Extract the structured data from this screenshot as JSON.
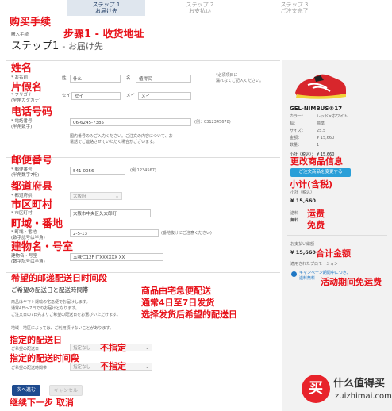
{
  "steps": [
    {
      "line1": "ステップ 1",
      "line2": "お届け先"
    },
    {
      "line1": "ステップ 2",
      "line2": "お支払い"
    },
    {
      "line1": "ステップ 3",
      "line2": "ご注文完了"
    }
  ],
  "header": {
    "subtitle": "購入手続",
    "title": "ステップ1",
    "title_suffix": "- お届け先"
  },
  "form": {
    "name_label": "* お名前",
    "name_sei_label": "姓",
    "name_sei_value": "什么",
    "name_mei_label": "名",
    "name_mei_value": "值得买",
    "required_note": "*必須項目に\n漏れなくご記入ください。",
    "kana_label": "* フリガナ\n(全角カタカナ)",
    "kana_sei_label": "セイ",
    "kana_sei_value": "セイ",
    "kana_mei_label": "メイ",
    "kana_mei_value": "メイ",
    "phone_label": "* 電話番号\n(半角数字)",
    "phone_value": "06-6245-7385",
    "phone_example": "(例：0312345678)",
    "phone_note": "国内番号のみご入力ください。ご注文の内容について、お\n電話でご連絡させていただく場合がございます。",
    "zip_label": "* 郵便番号\n(半角数字7桁)",
    "zip_value": "541-0056",
    "zip_example": "(例:1234567)",
    "pref_label": "* 都道府県",
    "pref_value": "大阪府",
    "city_label": "* 市区町村",
    "city_value": "大阪市中央区久太郎町",
    "street_label": "* 町域・番地\n(数字記号は半角)",
    "street_value": "2-5-13",
    "street_note": "(番地抜けにご注意ください)",
    "building_label": "建物名・号室\n(数字記号は半角)",
    "building_value": "五味仁12F JTXXXXXX XX"
  },
  "delivery": {
    "heading": "ご希望の配送日と配送時間帯",
    "text1": "商品はヤマト運輸の宅急便でお届けします。",
    "text2": "通常4日〜7日でのお届けとなります。",
    "text3": "ご注文日の7日先よりご希望の配送日をお選びいただけます。",
    "text4": "地域・地区によっては、ご利用頂けないことがあります。",
    "date_label": "ご希望の配送日",
    "date_value": "指定なし",
    "time_label": "ご希望の配送時間帯",
    "time_value": "指定なし"
  },
  "buttons": {
    "next": "次へ進む",
    "cancel": "キャンセル"
  },
  "sidebar": {
    "product_name": "GEL-NIMBUS®17",
    "rows": [
      {
        "k": "カラー：",
        "v": "レッド×ホワイト"
      },
      {
        "k": "幅：",
        "v": "標準"
      },
      {
        "k": "サイズ：",
        "v": "25.5"
      },
      {
        "k": "金額：",
        "v": "¥ 15,660"
      },
      {
        "k": "数量：",
        "v": "1"
      }
    ],
    "item_subtotal_label": "小計（税込）：",
    "item_subtotal_value": "¥ 15,660",
    "change_button": "ご注文商品を変更する",
    "subtotal_label": "小計（税込）",
    "subtotal_value": "¥ 15,660",
    "shipping_label": "送料",
    "shipping_value": "無料",
    "total_label": "お支払い総額",
    "total_value": "¥ 15,660",
    "promo_heading": "適用されたプロモーション",
    "promo_text": "キャンペーン期間中につき、\n送料無料"
  },
  "annotations": {
    "buy_procedure": "购买手续",
    "step1": "步骤1 - 收货地址",
    "name": "姓名",
    "kana": "片假名",
    "phone": "电话号码",
    "zip": "邮便番号",
    "pref": "都道府县",
    "city": "市区町村",
    "street": "町域・番地",
    "building": "建物名・号室",
    "delivery_heading": "希望的邮递配送日时间段",
    "delivery_info": "商品由宅急便配送\n通常4日至7日发货\n选择发货后希望的配送日",
    "date": "指定的配送日",
    "time": "指定的配送时间段",
    "not_specified_1": "不指定",
    "not_specified_2": "不指定",
    "next_cancel": "继续下一步   取消",
    "change_item": "更改商品信息",
    "subtotal": "小计(含税)",
    "shipping": "运费",
    "free": "免费",
    "total": "合计金额",
    "promo": "活动期间免运费"
  },
  "watermark": {
    "logo_char": "买",
    "text": "什么值得买",
    "url": "zuizhimai.com"
  }
}
